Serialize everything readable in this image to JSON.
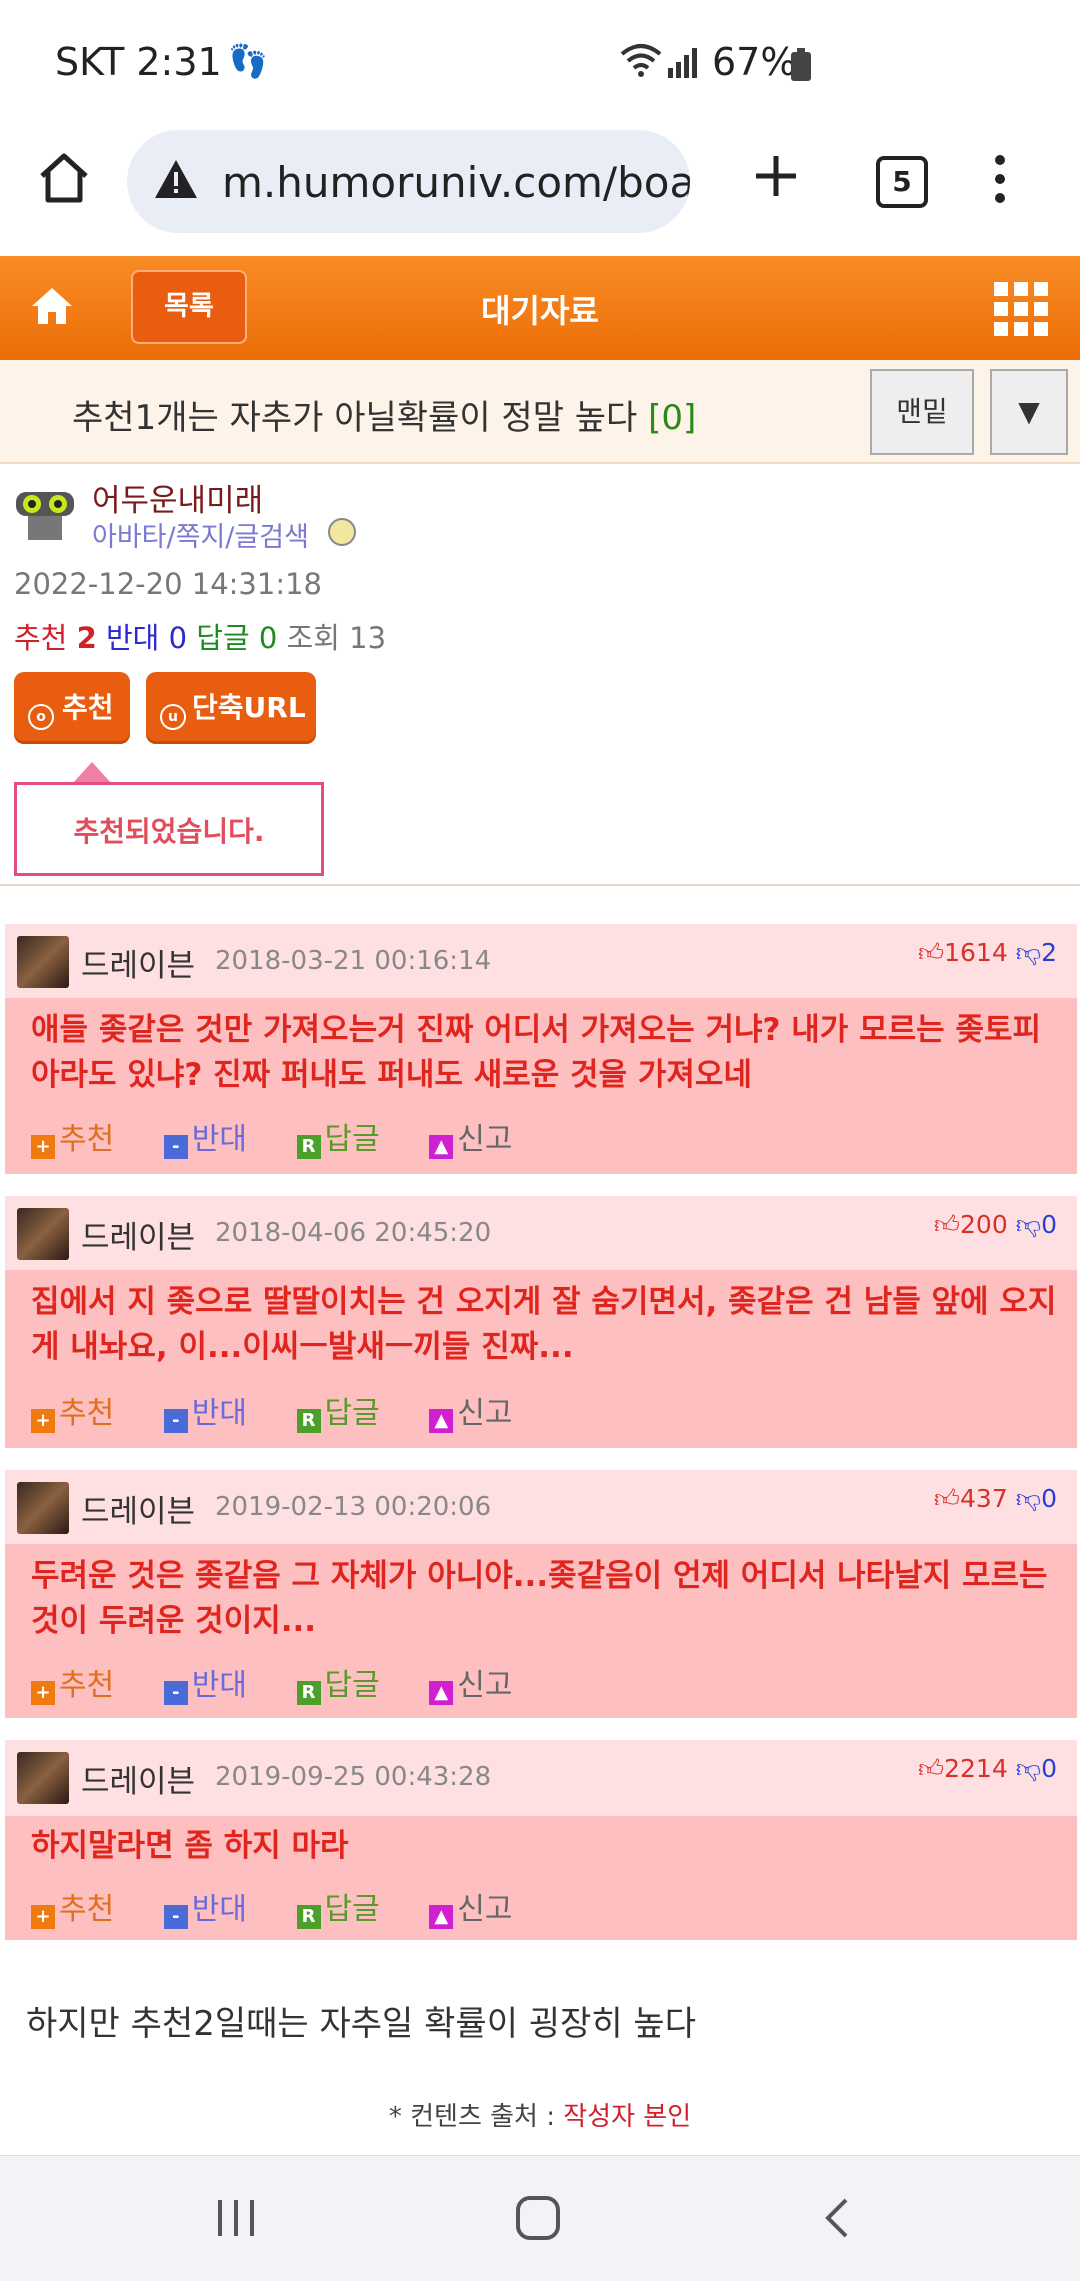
{
  "status_bar": {
    "time": "SKT 2:31",
    "battery": "67%"
  },
  "browser": {
    "url": "m.humoruniv.com/boa",
    "tab_count": "5"
  },
  "site_header": {
    "list_button": "목록",
    "title": "대기자료"
  },
  "post": {
    "title": "추천1개는 자추가 아닐확률이 정말 높다",
    "comment_count": "[0]",
    "bottom_button": "맨밑",
    "down_button": "▼",
    "author": "어두운내미래",
    "author_links": "아바타/쪽지/글검색",
    "date": "2022-12-20 14:31:18",
    "stats": {
      "recommend_label": "추천",
      "recommend": "2",
      "oppose_label": "반대",
      "oppose": "0",
      "reply_label": "답글",
      "reply": "0",
      "views_label": "조회",
      "views": "13"
    },
    "recommend_button": "추천",
    "short_url_button": "단축URL",
    "notice": "추천되었습니다.",
    "footer_text": "하지만 추천2일때는 자추일 확률이 굉장히 높다",
    "source_label": "* 컨텐츠 출처 :",
    "source_value": "작성자 본인"
  },
  "comment_actions": {
    "recommend": "추천",
    "oppose": "반대",
    "reply": "답글",
    "report": "신고"
  },
  "comments": [
    {
      "author": "드레이븐",
      "date": "2018-03-21 00:16:14",
      "up": "1614",
      "down": "2",
      "text": "애들 좆같은 것만 가져오는거 진짜 어디서 가져오는 거냐? 내가 모르는 좆토피아라도 있냐? 진짜 퍼내도 퍼내도 새로운 것을 가져오네"
    },
    {
      "author": "드레이븐",
      "date": "2018-04-06 20:45:20",
      "up": "200",
      "down": "0",
      "text": "집에서 지 좆으로 딸딸이치는 건 오지게 잘 숨기면서, 좆같은 건 남들 앞에 오지게 내놔요, 이...이씨ㅡ발새ㅡ끼들 진짜..."
    },
    {
      "author": "드레이븐",
      "date": "2019-02-13 00:20:06",
      "up": "437",
      "down": "0",
      "text": "두려운 것은 좆같음 그 자체가 아니야...좆같음이 언제 어디서 나타날지 모르는 것이 두려운 것이지..."
    },
    {
      "author": "드레이븐",
      "date": "2019-09-25 00:43:28",
      "up": "2214",
      "down": "0",
      "text": "하지말라면 좀 하지 마라"
    }
  ]
}
